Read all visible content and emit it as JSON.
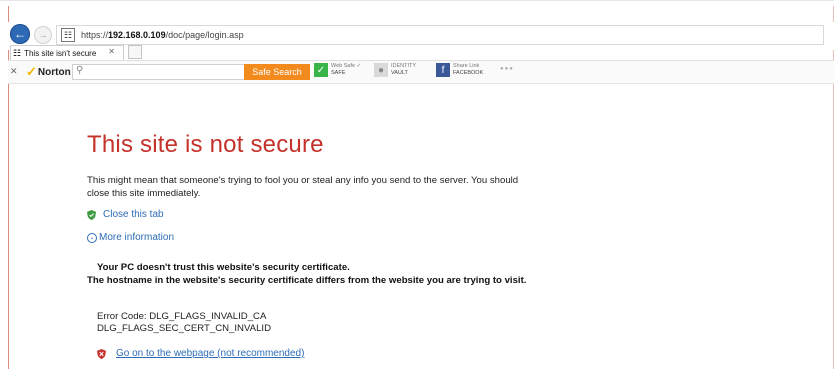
{
  "browser": {
    "url_prefix": "https://",
    "url_host": "192.168.0.109",
    "url_path": "/doc/page/login.asp",
    "tab_title": "This site isn't secure"
  },
  "norton": {
    "logo_label": "Norton",
    "safe_search_label": "Safe Search",
    "safe_status_top": "Web Safe ✓",
    "safe_status_label": "SAFE",
    "vault_top": "IDENTITY",
    "vault_label": "VAULT",
    "facebook_top": "Share Link",
    "facebook_label": "FACEBOOK"
  },
  "page": {
    "title": "This site is not secure",
    "intro": "This might mean that someone's trying to fool you or steal any info you send to the server. You should close this site immediately.",
    "close_tab": "Close this tab",
    "more_info": "More information",
    "warning_1": "Your PC doesn't trust this website's security certificate.",
    "warning_2": "The hostname in the website's security certificate differs from the website you are trying to visit.",
    "error_line_1": "Error Code: DLG_FLAGS_INVALID_CA",
    "error_line_2": "DLG_FLAGS_SEC_CERT_CN_INVALID",
    "go_on": "Go on to the webpage (not recommended)"
  },
  "colors": {
    "title_red": "#c4322b",
    "link_blue": "#2e6db5",
    "norton_orange": "#f28a1d"
  }
}
